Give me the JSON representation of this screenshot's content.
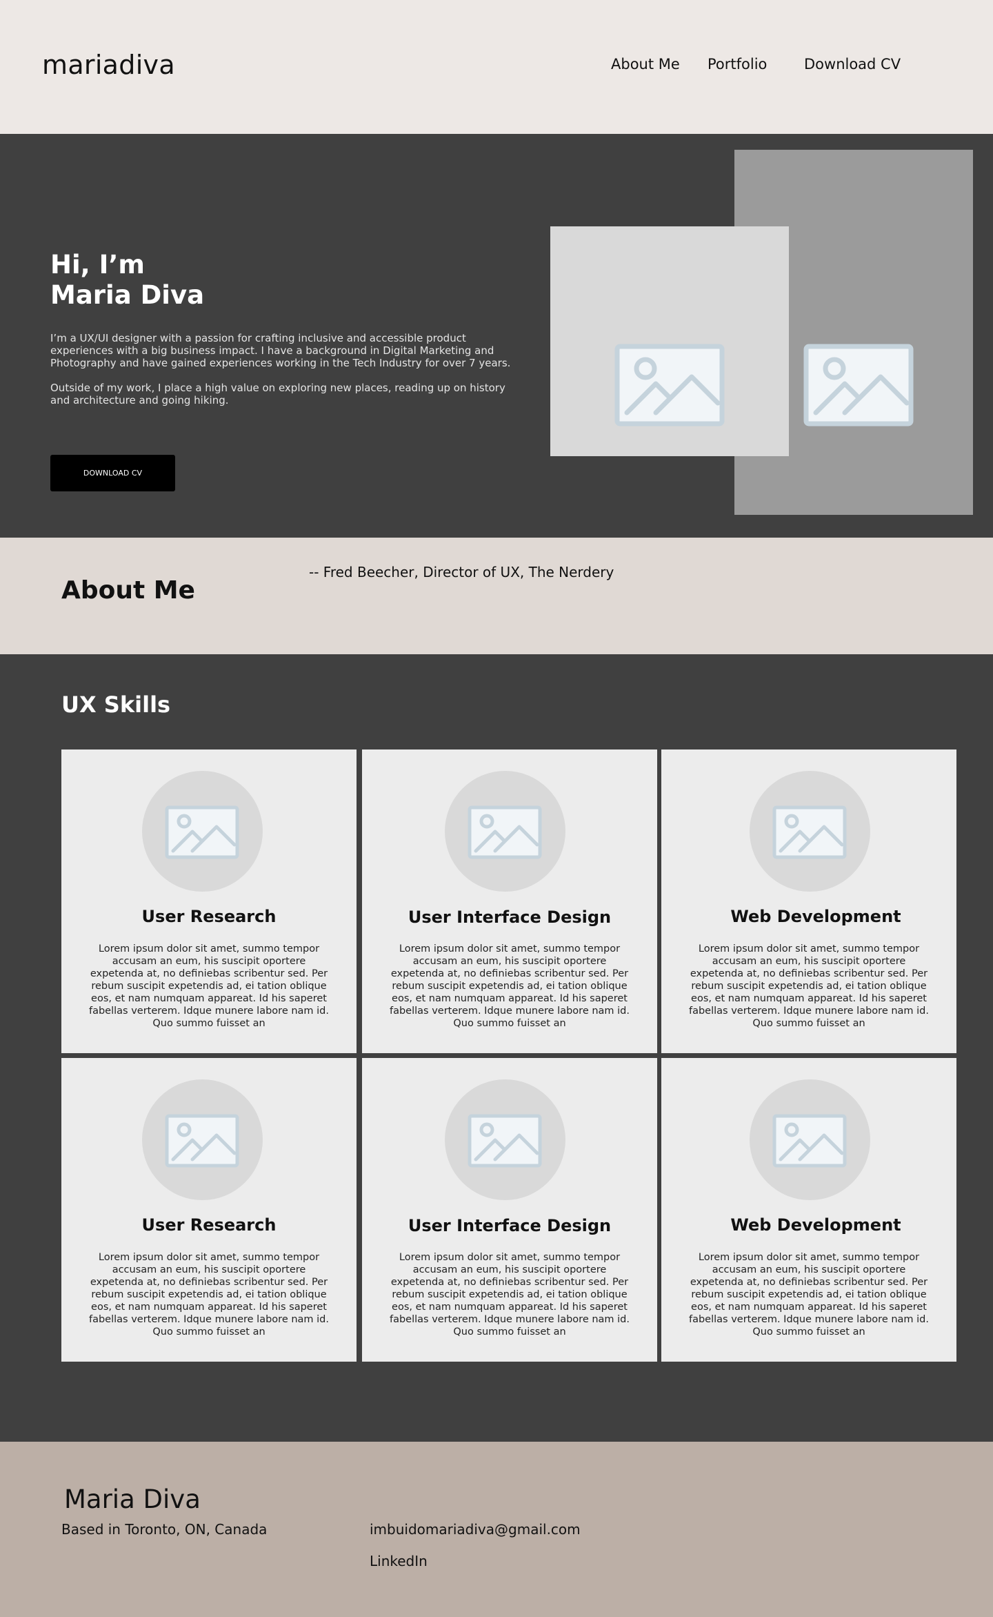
{
  "header": {
    "logo": "mariadiva",
    "nav": [
      {
        "label": "About Me"
      },
      {
        "label": "Portfolio"
      },
      {
        "label": "Download CV"
      }
    ]
  },
  "hero": {
    "title_line1": "Hi, I’m",
    "title_line2": "Maria Diva",
    "paragraph1": "I’m a UX/UI designer with a passion for crafting inclusive and accessible product experiences with a big business impact. I have a background in Digital Marketing and Photography and have gained experiences working in the Tech Industry for over 7 years.",
    "paragraph2": "Outside of my work, I place a high value on exploring new places, reading up on history and architecture and going hiking.",
    "button_label": "DOWNLOAD CV"
  },
  "about": {
    "title": "About Me",
    "quote_attribution": "-- Fred Beecher, Director of UX, The Nerdery"
  },
  "skills": {
    "title": "UX Skills",
    "cards": [
      {
        "title": "User Research",
        "text": "Lorem ipsum dolor sit amet, summo tempor accusam an eum, his suscipit oportere expetenda at, no definiebas scribentur sed. Per rebum suscipit expetendis ad, ei tation oblique eos, et nam numquam appareat. Id his saperet fabellas verterem. Idque munere labore nam id. Quo summo fuisset an"
      },
      {
        "title": "User Interface Design",
        "text": "Lorem ipsum dolor sit amet, summo tempor accusam an eum, his suscipit oportere expetenda at, no definiebas scribentur sed. Per rebum suscipit expetendis ad, ei tation oblique eos, et nam numquam appareat. Id his saperet fabellas verterem. Idque munere labore nam id. Quo summo fuisset an"
      },
      {
        "title": "Web Development",
        "text": "Lorem ipsum dolor sit amet, summo tempor accusam an eum, his suscipit oportere expetenda at, no definiebas scribentur sed. Per rebum suscipit expetendis ad, ei tation oblique eos, et nam numquam appareat. Id his saperet fabellas verterem. Idque munere labore nam id. Quo summo fuisset an"
      },
      {
        "title": "User Research",
        "text": "Lorem ipsum dolor sit amet, summo tempor accusam an eum, his suscipit oportere expetenda at, no definiebas scribentur sed. Per rebum suscipit expetendis ad, ei tation oblique eos, et nam numquam appareat. Id his saperet fabellas verterem. Idque munere labore nam id. Quo summo fuisset an"
      },
      {
        "title": "User Interface Design",
        "text": "Lorem ipsum dolor sit amet, summo tempor accusam an eum, his suscipit oportere expetenda at, no definiebas scribentur sed. Per rebum suscipit expetendis ad, ei tation oblique eos, et nam numquam appareat. Id his saperet fabellas verterem. Idque munere labore nam id. Quo summo fuisset an"
      },
      {
        "title": "Web Development",
        "text": "Lorem ipsum dolor sit amet, summo tempor accusam an eum, his suscipit oportere expetenda at, no definiebas scribentur sed. Per rebum suscipit expetendis ad, ei tation oblique eos, et nam numquam appareat. Id his saperet fabellas verterem. Idque munere labore nam id. Quo summo fuisset an"
      }
    ]
  },
  "footer": {
    "name": "Maria Diva",
    "location": "Based in Toronto, ON, Canada",
    "email": "imbuidomariadiva@gmail.com",
    "linkedin": "LinkedIn"
  },
  "colors": {
    "header_bg": "#ede8e5",
    "dark_bg": "#404040",
    "about_bg": "#e0d9d4",
    "footer_bg": "#bcafa6",
    "card_bg": "#ececec",
    "placeholder_icon": "#c5d3dc"
  },
  "icons": {
    "image_placeholder": "image-placeholder-icon"
  }
}
